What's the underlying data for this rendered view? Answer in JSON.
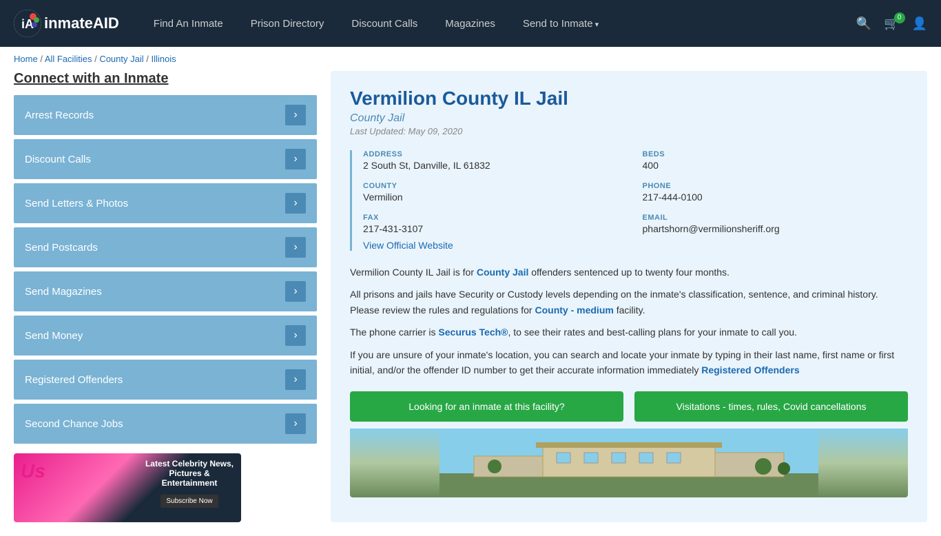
{
  "header": {
    "logo": "inmateAID",
    "nav": [
      {
        "label": "Find An Inmate",
        "dropdown": false
      },
      {
        "label": "Prison Directory",
        "dropdown": false
      },
      {
        "label": "Discount Calls",
        "dropdown": false
      },
      {
        "label": "Magazines",
        "dropdown": false
      },
      {
        "label": "Send to Inmate",
        "dropdown": true
      }
    ],
    "cart_count": "0",
    "icons": {
      "search": "🔍",
      "cart": "🛒",
      "user": "👤"
    }
  },
  "breadcrumb": {
    "home": "Home",
    "all_facilities": "All Facilities",
    "county_jail": "County Jail",
    "state": "Illinois",
    "separator": " / "
  },
  "sidebar": {
    "connect_title": "Connect with an Inmate",
    "items": [
      {
        "label": "Arrest Records"
      },
      {
        "label": "Discount Calls"
      },
      {
        "label": "Send Letters & Photos"
      },
      {
        "label": "Send Postcards"
      },
      {
        "label": "Send Magazines"
      },
      {
        "label": "Send Money"
      },
      {
        "label": "Registered Offenders"
      },
      {
        "label": "Second Chance Jobs"
      }
    ],
    "ad": {
      "brand": "Us",
      "title": "Latest Celebrity News, Pictures & Entertainment",
      "button": "Subscribe Now"
    }
  },
  "facility": {
    "name": "Vermilion County IL Jail",
    "type": "County Jail",
    "last_updated": "Last Updated: May 09, 2020",
    "address_label": "ADDRESS",
    "address_value": "2 South St, Danville, IL 61832",
    "beds_label": "BEDS",
    "beds_value": "400",
    "county_label": "COUNTY",
    "county_value": "Vermilion",
    "phone_label": "PHONE",
    "phone_value": "217-444-0100",
    "fax_label": "FAX",
    "fax_value": "217-431-3107",
    "email_label": "EMAIL",
    "email_value": "phartshorn@vermilionsheriff.org",
    "official_website": "View Official Website",
    "desc1": "Vermilion County IL Jail is for County Jail offenders sentenced up to twenty four months.",
    "desc2": "All prisons and jails have Security or Custody levels depending on the inmate's classification, sentence, and criminal history. Please review the rules and regulations for County - medium facility.",
    "desc3": "The phone carrier is Securus Tech®, to see their rates and best-calling plans for your inmate to call you.",
    "desc4": "If you are unsure of your inmate's location, you can search and locate your inmate by typing in their last name, first name or first initial, and/or the offender ID number to get their accurate information immediately Registered Offenders",
    "btn1": "Looking for an inmate at this facility?",
    "btn2": "Visitations - times, rules, Covid cancellations"
  }
}
